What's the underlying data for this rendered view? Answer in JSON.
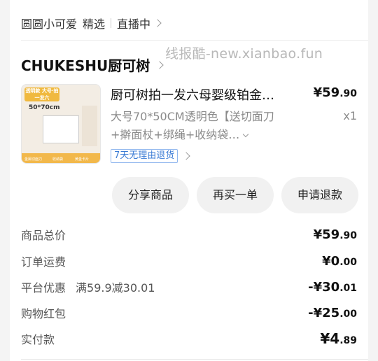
{
  "header": {
    "store_name": "圆圆小可爱",
    "badge": "精选",
    "live": "直播中"
  },
  "watermark": "线报酷-new.xianbao.fun",
  "shop": {
    "name": "CHUKESHU厨可树"
  },
  "product": {
    "title": "厨可树拍一发六母婴级铂金…",
    "price_int": "¥59",
    "price_dec": ".90",
    "spec": "大号70*50CM透明色【送切面刀+擀面杖+绑绳+收纳袋…",
    "quantity": "x1",
    "return_tag": "7天无理由退货",
    "image": {
      "header": "透明款 大号·拍一发六",
      "size": "50*70cm",
      "captions": [
        "金属切面刀",
        "收纳袋",
        "黄金卡片"
      ]
    }
  },
  "actions": {
    "share": "分享商品",
    "rebuy": "再买一单",
    "refund": "申请退款"
  },
  "summary": {
    "total_label": "商品总价",
    "total_int": "¥59",
    "total_dec": ".90",
    "shipping_label": "订单运费",
    "shipping_int": "¥0",
    "shipping_dec": ".00",
    "discount_label": "平台优惠",
    "discount_note": "满59.9减30.01",
    "discount_int": "-¥30",
    "discount_dec": ".01",
    "redpacket_label": "购物红包",
    "redpacket_int": "-¥25",
    "redpacket_dec": ".00",
    "paid_label": "实付款",
    "paid_int": "¥4",
    "paid_dec": ".89"
  }
}
